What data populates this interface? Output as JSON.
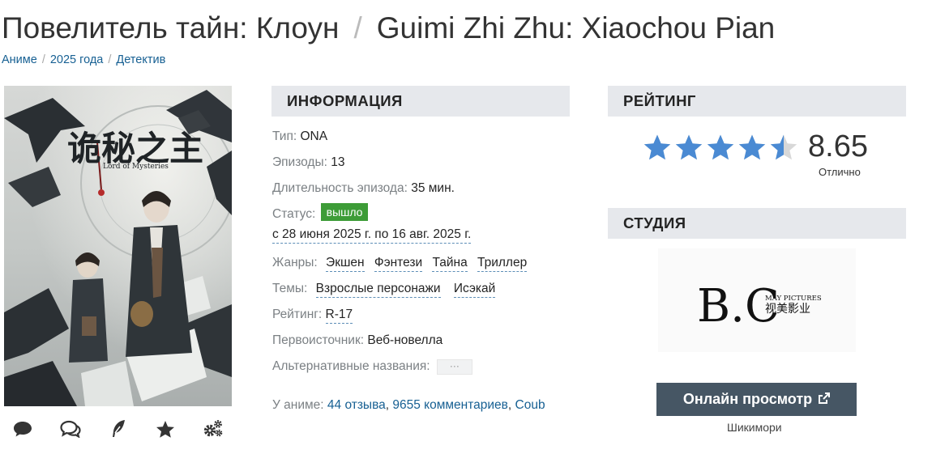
{
  "page": {
    "title_ru": "Повелитель тайн: Клоун",
    "title_sep": "/",
    "title_en": "Guimi Zhi Zhu: Xiaochou Pian"
  },
  "breadcrumb": [
    "Аниме",
    "2025 года",
    "Детектив"
  ],
  "poster": {
    "title_cn": "诡秘之主",
    "title_en": "Lord of Mysteries"
  },
  "poster_actions": [
    "comment-icon",
    "comments-icon",
    "feather-icon",
    "star-icon",
    "cogs-icon"
  ],
  "info": {
    "heading": "ИНФОРМАЦИЯ",
    "type_label": "Тип:",
    "type_value": "ONA",
    "episodes_label": "Эпизоды:",
    "episodes_value": "13",
    "duration_label": "Длительность эпизода:",
    "duration_value": "35 мин.",
    "status_label": "Статус:",
    "status_value": "вышло",
    "dates": "с 28 июня 2025 г. по 16 авг. 2025 г.",
    "genres_label": "Жанры:",
    "genres": [
      "Экшен",
      "Фэнтези",
      "Тайна",
      "Триллер"
    ],
    "themes_label": "Темы:",
    "themes": [
      "Взрослые персонажи",
      "Исэкай"
    ],
    "rating_label": "Рейтинг:",
    "rating_value": "R-17",
    "source_label": "Первоисточник:",
    "source_value": "Веб-новелла",
    "alt_names_label": "Альтернативные названия:",
    "alt_names_button": "···"
  },
  "about": {
    "label": "У аниме:",
    "reviews": "44 отзыва",
    "comments": "9655 комментариев",
    "coub": "Coub"
  },
  "rating": {
    "heading": "РЕЙТИНГ",
    "score": "8.65",
    "score_value": 8.65,
    "stars_filled": 4.5,
    "stars_total": 5,
    "label": "Отлично"
  },
  "studio": {
    "heading": "СТУДИЯ",
    "logo_letters": "B.C",
    "logo_en": "MAY PICTURES",
    "logo_cn": "视美影业"
  },
  "watch": {
    "button": "Онлайн просмотр",
    "provider": "Шикимори"
  },
  "colors": {
    "link": "#176093",
    "status_green": "#3d9c37",
    "star_blue": "#4a8ad3",
    "button_dark": "#465664",
    "section_bg": "#e6e8ec"
  }
}
